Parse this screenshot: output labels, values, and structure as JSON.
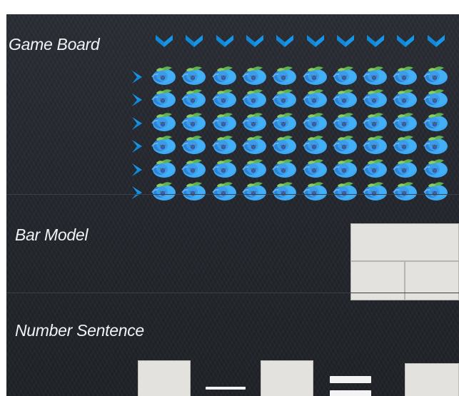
{
  "panels": {
    "game_board": {
      "title": "Game Board",
      "rows": 6,
      "columns": 10
    },
    "bar_model": {
      "title": "Bar Model"
    },
    "number_sentence": {
      "title": "Number Sentence",
      "operator": "minus",
      "equals": "equals"
    }
  },
  "icons": {
    "column_arrow": "down-chevron-icon",
    "row_arrow": "right-chevron-icon",
    "board_item": "blueberry-icon"
  },
  "colors": {
    "background": "#25282e",
    "divider": "#3b3f47",
    "arrow_blue": "#1696e8",
    "berry_blue": "#3ea9f4",
    "berry_shadow": "#2a75cb",
    "leaf_green": "#60b04f",
    "box_fill": "#e3e2df",
    "text": "#f1f3f6",
    "operator": "#f3f3f3"
  }
}
